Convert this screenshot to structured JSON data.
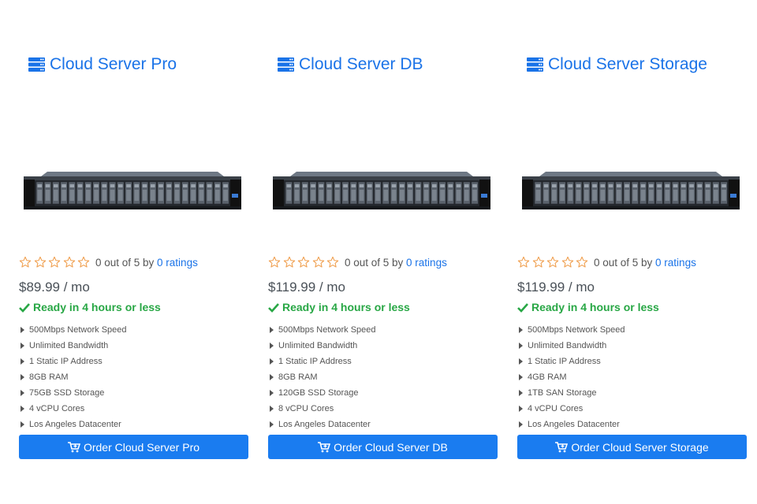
{
  "products": [
    {
      "title": "Cloud Server Pro",
      "image_alt": "rack server",
      "rating": {
        "stars": 0,
        "text_prefix": "0 out of 5 by",
        "link": "0 ratings"
      },
      "price": "$89.99 / mo",
      "ready": "Ready in 4 hours or less",
      "features": [
        "500Mbps Network Speed",
        "Unlimited Bandwidth",
        "1 Static IP Address",
        "8GB RAM",
        "75GB SSD Storage",
        "4 vCPU Cores",
        "Los Angeles Datacenter"
      ],
      "button": "Order Cloud Server Pro"
    },
    {
      "title": "Cloud Server DB",
      "image_alt": "rack server",
      "rating": {
        "stars": 0,
        "text_prefix": "0 out of 5 by",
        "link": "0 ratings"
      },
      "price": "$119.99 / mo",
      "ready": "Ready in 4 hours or less",
      "features": [
        "500Mbps Network Speed",
        "Unlimited Bandwidth",
        "1 Static IP Address",
        "8GB RAM",
        "120GB SSD Storage",
        "8 vCPU Cores",
        "Los Angeles Datacenter"
      ],
      "button": "Order Cloud Server DB"
    },
    {
      "title": "Cloud Server Storage",
      "image_alt": "rack server",
      "rating": {
        "stars": 0,
        "text_prefix": "0 out of 5 by",
        "link": "0 ratings"
      },
      "price": "$119.99 / mo",
      "ready": "Ready in 4 hours or less",
      "features": [
        "500Mbps Network Speed",
        "Unlimited Bandwidth",
        "1 Static IP Address",
        "4GB RAM",
        "1TB SAN Storage",
        "4 vCPU Cores",
        "Los Angeles Datacenter"
      ],
      "button": "Order Cloud Server Storage"
    }
  ],
  "icons": {
    "title": "server-icon",
    "star": "star-outline-icon",
    "ready": "check-icon",
    "feature": "caret-right-icon",
    "button": "cart-plus-icon"
  },
  "colors": {
    "link": "#1a73e8",
    "ready": "#28a745",
    "star": "#f0a050",
    "button": "#1a7cf0"
  }
}
